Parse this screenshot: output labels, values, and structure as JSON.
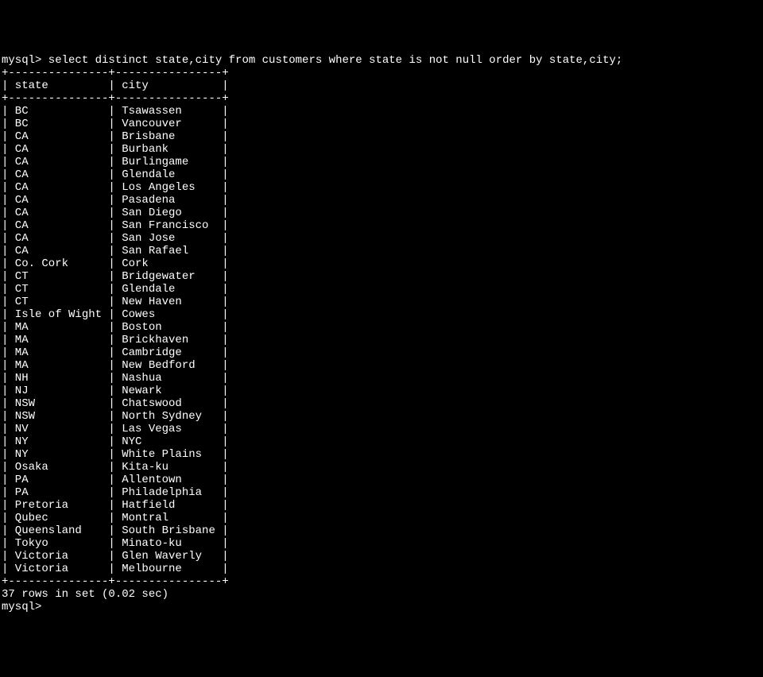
{
  "prompt_prefix": "mysql>",
  "query_command": "select distinct state,city from customers where state is not null order by state,city;",
  "columns": {
    "state_header": "state",
    "city_header": "city"
  },
  "col_widths": {
    "state": 15,
    "city": 16
  },
  "rows": [
    {
      "state": "BC",
      "city": "Tsawassen"
    },
    {
      "state": "BC",
      "city": "Vancouver"
    },
    {
      "state": "CA",
      "city": "Brisbane"
    },
    {
      "state": "CA",
      "city": "Burbank"
    },
    {
      "state": "CA",
      "city": "Burlingame"
    },
    {
      "state": "CA",
      "city": "Glendale"
    },
    {
      "state": "CA",
      "city": "Los Angeles"
    },
    {
      "state": "CA",
      "city": "Pasadena"
    },
    {
      "state": "CA",
      "city": "San Diego"
    },
    {
      "state": "CA",
      "city": "San Francisco"
    },
    {
      "state": "CA",
      "city": "San Jose"
    },
    {
      "state": "CA",
      "city": "San Rafael"
    },
    {
      "state": "Co. Cork",
      "city": "Cork"
    },
    {
      "state": "CT",
      "city": "Bridgewater"
    },
    {
      "state": "CT",
      "city": "Glendale"
    },
    {
      "state": "CT",
      "city": "New Haven"
    },
    {
      "state": "Isle of Wight",
      "city": "Cowes"
    },
    {
      "state": "MA",
      "city": "Boston"
    },
    {
      "state": "MA",
      "city": "Brickhaven"
    },
    {
      "state": "MA",
      "city": "Cambridge"
    },
    {
      "state": "MA",
      "city": "New Bedford"
    },
    {
      "state": "NH",
      "city": "Nashua"
    },
    {
      "state": "NJ",
      "city": "Newark"
    },
    {
      "state": "NSW",
      "city": "Chatswood"
    },
    {
      "state": "NSW",
      "city": "North Sydney"
    },
    {
      "state": "NV",
      "city": "Las Vegas"
    },
    {
      "state": "NY",
      "city": "NYC"
    },
    {
      "state": "NY",
      "city": "White Plains"
    },
    {
      "state": "Osaka",
      "city": "Kita-ku"
    },
    {
      "state": "PA",
      "city": "Allentown"
    },
    {
      "state": "PA",
      "city": "Philadelphia"
    },
    {
      "state": "Pretoria",
      "city": "Hatfield"
    },
    {
      "state": "Qubec",
      "city": "Montral"
    },
    {
      "state": "Queensland",
      "city": "South Brisbane"
    },
    {
      "state": "Tokyo",
      "city": "Minato-ku"
    },
    {
      "state": "Victoria",
      "city": "Glen Waverly"
    },
    {
      "state": "Victoria",
      "city": "Melbourne"
    }
  ],
  "result_summary": "37 rows in set (0.02 sec)",
  "final_prompt": "mysql>"
}
